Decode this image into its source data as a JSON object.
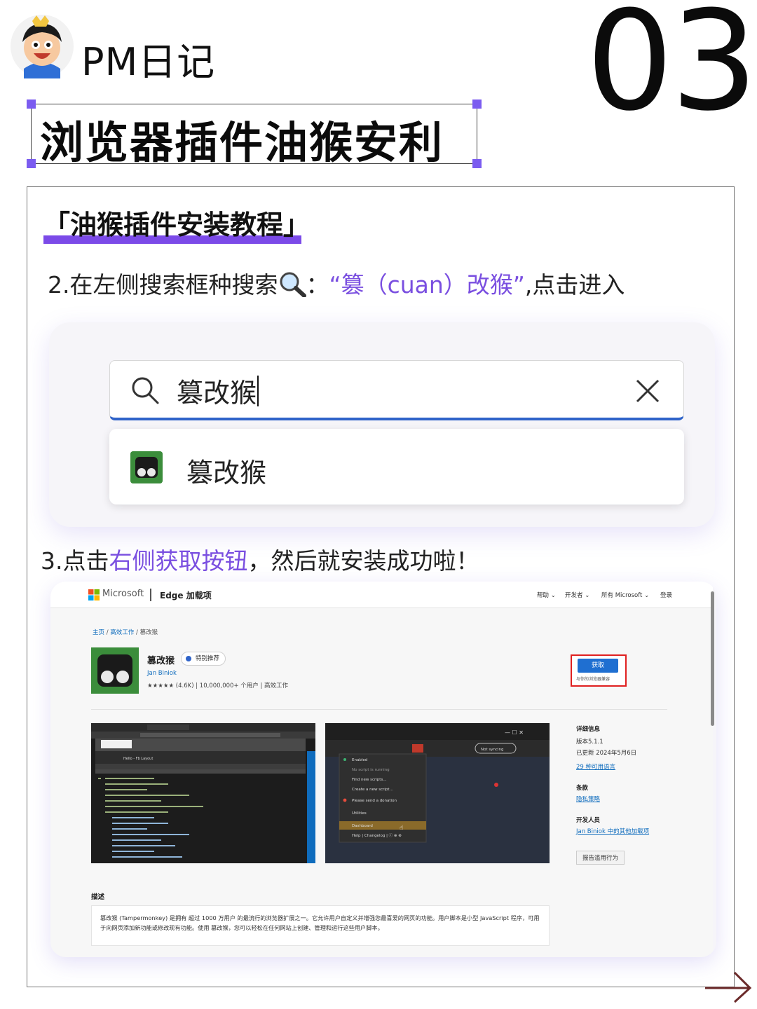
{
  "header": {
    "brand": "PM日记",
    "page_number": "03",
    "title": "浏览器插件油猴安利"
  },
  "section": {
    "title": "「油猴插件安装教程」"
  },
  "step2": {
    "prefix": "2.在左侧搜索框种搜索",
    "colon": "：",
    "highlight": "“篡（cuan）改猴”",
    "suffix": ",点击进入"
  },
  "search_mock": {
    "query": "篡改猴",
    "suggestion": "篡改猴"
  },
  "step3": {
    "prefix": "3.点击",
    "highlight": "右侧获取按钮",
    "suffix": "，然后就安装成功啦！"
  },
  "addon_page": {
    "ms_brand": "Microsoft",
    "site_name": "Edge 加载项",
    "nav": [
      "帮助 ⌄",
      "开发者 ⌄",
      "所有 Microsoft ⌄",
      "登录"
    ],
    "breadcrumb": {
      "home": "主页",
      "sep1": " / ",
      "category": "高效工作",
      "sep2": " / ",
      "current": "篡改猴"
    },
    "extension": {
      "name": "篡改猴",
      "badge": "特别推荐",
      "developer": "Jan Biniok",
      "meta": "★★★★★ (4.6K) | 10,000,000+ 个用户 | 高效工作"
    },
    "get_button": "获取",
    "get_sub": "与你的浏览器兼容",
    "details": {
      "heading": "详细信息",
      "version": "版本5.1.1",
      "updated": "已更新 2024年5月6日",
      "languages": "29 种可用语言",
      "terms_heading": "条款",
      "privacy": "隐私策略",
      "developer_heading": "开发人员",
      "developer_link": "Jan Biniok 中的其他加载项",
      "report": "报告滥用行为"
    },
    "description": {
      "heading": "描述",
      "text": "篡改猴 (Tampermonkey) 是拥有 超过 1000 万用户 的最流行的浏览器扩展之一。它允许用户自定义并增强您最喜爱的网页的功能。用户脚本是小型 JavaScript 程序，可用于向网页添加新功能或修改现有功能。使用 篡改猴，您可以轻松在任何网站上创建、管理和运行这些用户脚本。"
    },
    "menu_items": [
      "Enabled",
      "No script is running",
      "Find new scripts...",
      "Create a new script...",
      "Please send a donation",
      "Utilities",
      "Dashboard",
      "Help | Changelog | ⓘ ⊕ ⊗"
    ],
    "screenshot1_title": "Hello - Fb Layout",
    "not_syncing": "Not syncing"
  },
  "colors": {
    "accent_purple": "#7b4ae8",
    "highlight_text": "#7a4fe0",
    "edge_blue": "#1f6fd1",
    "red_frame": "#e02020",
    "tampermonkey_green": "#3b8d3b"
  }
}
